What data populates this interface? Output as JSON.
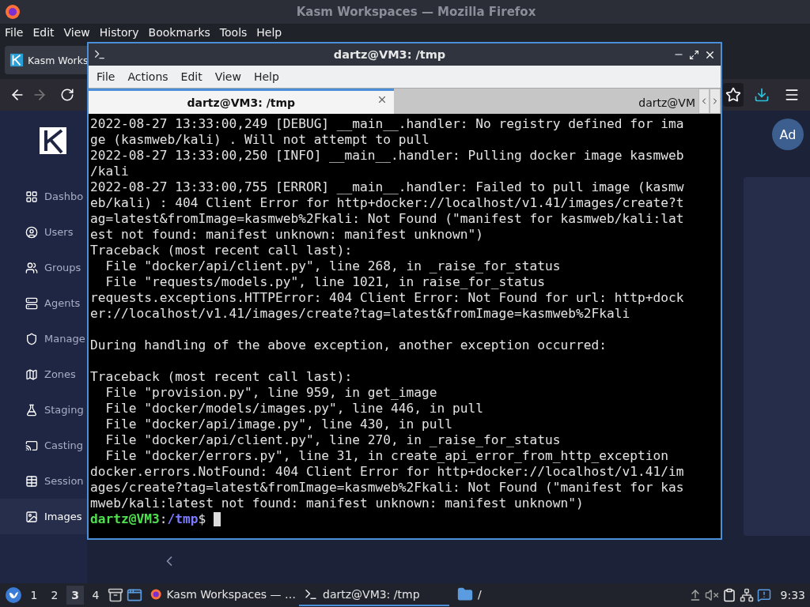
{
  "browser": {
    "title": "Kasm Workspaces — Mozilla Firefox",
    "menu": [
      "File",
      "Edit",
      "View",
      "History",
      "Bookmarks",
      "Tools",
      "Help"
    ],
    "tab": {
      "label": "Kasm Works"
    }
  },
  "sidebar": {
    "items": [
      {
        "label": "Dashbo",
        "kind": "dashboard",
        "selected": false
      },
      {
        "label": "Users",
        "kind": "users",
        "selected": false
      },
      {
        "label": "Groups",
        "kind": "groups",
        "selected": false
      },
      {
        "label": "Agents",
        "kind": "agents",
        "selected": false
      },
      {
        "label": "Manage",
        "kind": "shield",
        "selected": false
      },
      {
        "label": "Zones",
        "kind": "zones",
        "selected": false
      },
      {
        "label": "Staging",
        "kind": "staging",
        "selected": false
      },
      {
        "label": "Casting",
        "kind": "casting",
        "selected": false
      },
      {
        "label": "Session",
        "kind": "sessions",
        "selected": false
      },
      {
        "label": "Images",
        "kind": "images",
        "selected": true
      }
    ]
  },
  "avatar": "Ad",
  "terminal": {
    "title": "dartz@VM3: /tmp",
    "menu": [
      "File",
      "Actions",
      "Edit",
      "View",
      "Help"
    ],
    "tabs": [
      {
        "label": "dartz@VM3: /tmp",
        "selected": true
      },
      {
        "label": "dartz@VM",
        "selected": false
      }
    ],
    "blocks": [
      [
        "2022-08-27 13:33:00,249 [DEBUG] __main__.handler: No registry defined for ima",
        "ge (kasmweb/kali) . Will not attempt to pull",
        "2022-08-27 13:33:00,250 [INFO] __main__.handler: Pulling docker image kasmweb",
        "/kali",
        "2022-08-27 13:33:00,755 [ERROR] __main__.handler: Failed to pull image (kasmw",
        "eb/kali) : 404 Client Error for http+docker://localhost/v1.41/images/create?t",
        "ag=latest&fromImage=kasmweb%2Fkali: Not Found (\"manifest for kasmweb/kali:lat",
        "est not found: manifest unknown: manifest unknown\")",
        "Traceback (most recent call last):",
        "  File \"docker/api/client.py\", line 268, in _raise_for_status",
        "  File \"requests/models.py\", line 1021, in raise_for_status",
        "requests.exceptions.HTTPError: 404 Client Error: Not Found for url: http+dock",
        "er://localhost/v1.41/images/create?tag=latest&fromImage=kasmweb%2Fkali"
      ],
      [
        "During handling of the above exception, another exception occurred:"
      ],
      [
        "Traceback (most recent call last):",
        "  File \"provision.py\", line 959, in get_image",
        "  File \"docker/models/images.py\", line 446, in pull",
        "  File \"docker/api/image.py\", line 430, in pull",
        "  File \"docker/api/client.py\", line 270, in _raise_for_status",
        "  File \"docker/errors.py\", line 31, in create_api_error_from_http_exception",
        "docker.errors.NotFound: 404 Client Error for http+docker://localhost/v1.41/im",
        "ages/create?tag=latest&fromImage=kasmweb%2Fkali: Not Found (\"manifest for kas",
        "mweb/kali:latest not found: manifest unknown: manifest unknown\")"
      ]
    ],
    "prompt": {
      "user_host": "dartz@VM3",
      "separator": ":",
      "path": "/tmp",
      "symbol": "$"
    }
  },
  "taskbar": {
    "workspaces": [
      {
        "label": "1",
        "selected": false
      },
      {
        "label": "2",
        "selected": false
      },
      {
        "label": "3",
        "selected": true
      },
      {
        "label": "4",
        "selected": false
      }
    ],
    "tasks": [
      {
        "label": "Kasm Workspaces — …",
        "kind": "browser",
        "selected": false
      },
      {
        "label": "dartz@VM3: /tmp",
        "kind": "terminal",
        "selected": true
      },
      {
        "label": "/",
        "kind": "folder",
        "selected": false
      }
    ],
    "clock": "9:33"
  }
}
